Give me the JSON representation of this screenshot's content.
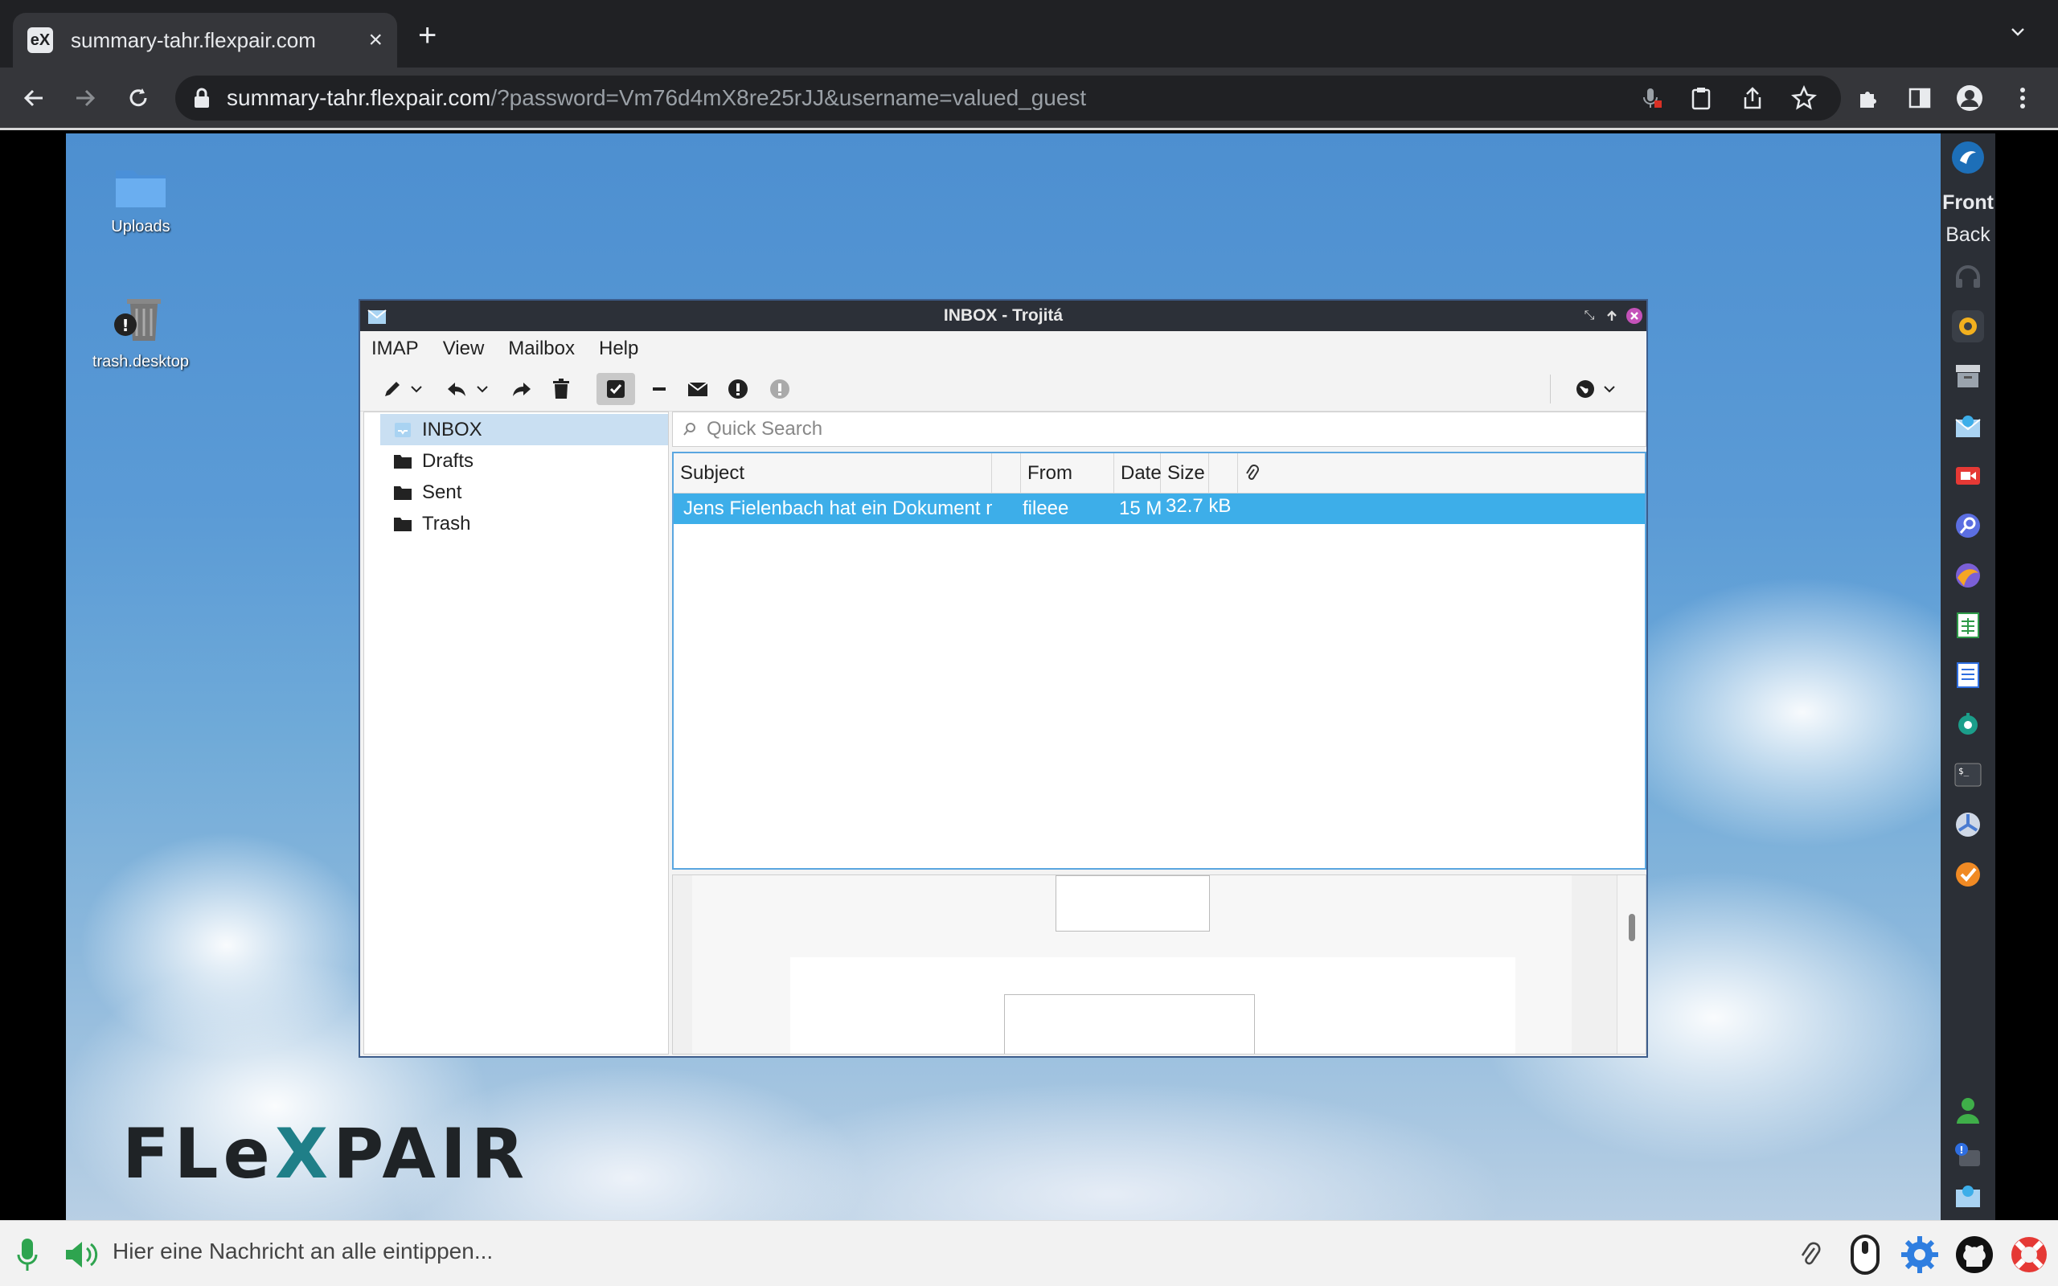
{
  "browser": {
    "tab_title": "summary-tahr.flexpair.com",
    "tab_favicon": "eX",
    "url_host": "summary-tahr.flexpair.com",
    "url_rest": "/?password=Vm76d4mX8re25rJJ&username=valued_guest"
  },
  "desktop": {
    "icons": [
      {
        "label": "Uploads",
        "icon": "folder-icon"
      },
      {
        "label": "trash.desktop",
        "icon": "trash-icon"
      }
    ],
    "brand": {
      "part1": "FLe",
      "part2": "X",
      "part3": "PAIR"
    }
  },
  "dock": {
    "front_label": "Front",
    "back_label": "Back"
  },
  "window": {
    "title": "INBOX - Trojitá",
    "menu": [
      "IMAP",
      "View",
      "Mailbox",
      "Help"
    ],
    "folders": [
      "INBOX",
      "Drafts",
      "Sent",
      "Trash"
    ],
    "selected_folder": "INBOX",
    "search_placeholder": "Quick Search",
    "columns": [
      "Subject",
      "From",
      "Date",
      "Size"
    ],
    "messages": [
      {
        "subject": "Jens Fielenbach hat ein Dokument mit Dir geteilt",
        "from": "fileee",
        "date": "15 M...",
        "size": "32.7 kB"
      }
    ]
  },
  "chat": {
    "placeholder": "Hier eine Nachricht an alle eintippen..."
  },
  "colors": {
    "selection": "#3daee9",
    "titlebar": "#2c3038",
    "chrome_bg": "#202124"
  }
}
